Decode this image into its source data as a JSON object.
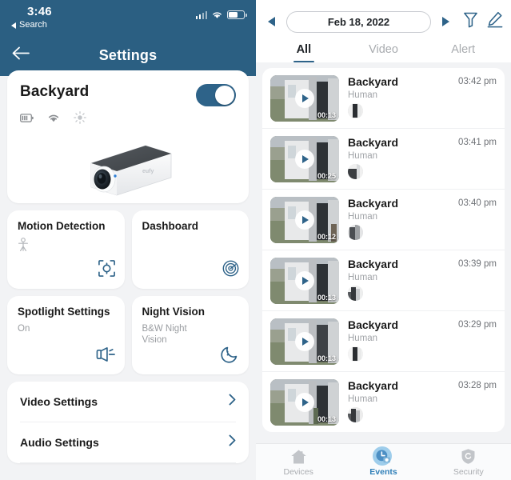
{
  "left": {
    "statusbar": {
      "time": "3:46",
      "back_app": "Search",
      "battery_icon": "battery-icon",
      "wifi_icon": "wifi-icon",
      "signal_icon": "signal-bars-icon"
    },
    "nav": {
      "back_icon": "back-arrow-icon",
      "title": "Settings"
    },
    "device": {
      "name": "Backyard",
      "power_toggle_state": "on",
      "status_icons": [
        "battery-level-icon",
        "wifi-status-icon",
        "brightness-icon"
      ],
      "image_alt": "solar-security-camera-image"
    },
    "tiles": [
      {
        "title": "Motion Detection",
        "subtitle": "",
        "icon": "motion-detection-icon",
        "badge_icon": "human-figure-icon"
      },
      {
        "title": "Dashboard",
        "subtitle": "",
        "icon": "dashboard-radar-icon",
        "badge_icon": ""
      },
      {
        "title": "Spotlight Settings",
        "subtitle": "On",
        "icon": "spotlight-icon",
        "badge_icon": ""
      },
      {
        "title": "Night Vision",
        "subtitle": "B&W Night Vision",
        "icon": "moon-night-vision-icon",
        "badge_icon": ""
      }
    ],
    "list_rows": [
      {
        "label": "Video Settings",
        "chevron": "chevron-right-icon"
      },
      {
        "label": "Audio Settings",
        "chevron": "chevron-right-icon"
      }
    ]
  },
  "right": {
    "header": {
      "prev_icon": "triangle-left-icon",
      "next_icon": "triangle-right-icon",
      "date": "Feb 18, 2022",
      "filter_icon": "filter-funnel-icon",
      "edit_icon": "pencil-edit-icon"
    },
    "tabs": [
      {
        "label": "All",
        "active": true
      },
      {
        "label": "Video",
        "active": false
      },
      {
        "label": "Alert",
        "active": false
      }
    ],
    "events": [
      {
        "title": "Backyard",
        "type": "Human",
        "time": "03:42 pm",
        "duration": "00:13"
      },
      {
        "title": "Backyard",
        "type": "Human",
        "time": "03:41 pm",
        "duration": "00:25"
      },
      {
        "title": "Backyard",
        "type": "Human",
        "time": "03:40 pm",
        "duration": "00:12"
      },
      {
        "title": "Backyard",
        "type": "Human",
        "time": "03:39 pm",
        "duration": "00:13"
      },
      {
        "title": "Backyard",
        "type": "Human",
        "time": "03:29 pm",
        "duration": "00:13"
      },
      {
        "title": "Backyard",
        "type": "Human",
        "time": "03:28 pm",
        "duration": "00:13"
      }
    ],
    "tabbar": [
      {
        "label": "Devices",
        "icon": "home-icon",
        "active": false
      },
      {
        "label": "Events",
        "icon": "events-clock-icon",
        "active": true
      },
      {
        "label": "Security",
        "icon": "shield-icon",
        "active": false
      }
    ]
  },
  "colors": {
    "header_blue": "#2b5f82",
    "accent_blue": "#2e6389",
    "active_tab_blue": "#2f7fb8",
    "page_bg": "#f2f3f5",
    "card_bg": "#ffffff"
  }
}
